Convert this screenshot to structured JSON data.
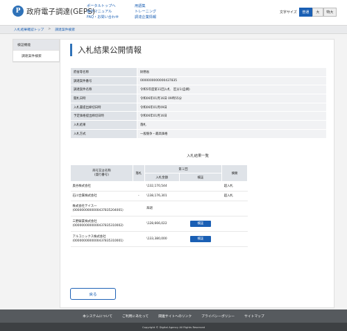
{
  "header": {
    "logo_mark": "P",
    "logo_text": "政府電子調達(GEPS)",
    "links_col1": [
      "ポータルトップへ",
      "操作マニュアル",
      "FAQ・お問い合わせ"
    ],
    "links_col2": [
      "用語集",
      "トレーニング",
      "調達企業情報"
    ],
    "font_size_label": "文字サイズ",
    "font_sizes": [
      "普通",
      "大",
      "特大"
    ],
    "font_size_selected": "普通"
  },
  "breadcrumb": [
    "入札結果確認トップ",
    "調達案件検索"
  ],
  "sidebar": {
    "items": [
      {
        "label": "検証機能"
      },
      {
        "label": "調達案件検索"
      }
    ]
  },
  "main": {
    "title": "入札結果公開情報",
    "info_rows": [
      {
        "label": "府省等名称",
        "value": "財務省"
      },
      {
        "label": "調達案件番号",
        "value": "0000000000000437835"
      },
      {
        "label": "調達案件名称",
        "value": "令和5年度第11回入札　区分1(自網)"
      },
      {
        "label": "開札日時",
        "value": "令和06年01月16日 09時55分"
      },
      {
        "label": "入札書提出締切日時",
        "value": "令和06年01月09日"
      },
      {
        "label": "予定価格提出締切日時",
        "value": "令和06年01月16日"
      },
      {
        "label": "入札結果",
        "value": "落札"
      },
      {
        "label": "入札方式",
        "value": "一般競争・最高価格"
      }
    ],
    "results_title": "入札結果一覧",
    "results_headers": {
      "name": "商号又は名称\n(発行番号)",
      "rank": "落札",
      "round": "第１回",
      "amount": "入札金額",
      "check": "検証",
      "note": "摘要"
    },
    "results_rows": [
      {
        "name": "奥谷株式会社",
        "number": "",
        "rank": "",
        "amount": "\\132,170,544",
        "check": "",
        "note": "超入札"
      },
      {
        "name": "石川合属株式会社",
        "number": "",
        "rank": "-",
        "amount": "\\138,176,301",
        "check": "",
        "note": "超入札"
      },
      {
        "name": "株式会社テイス一",
        "number": "(0000000000000437835204001)",
        "rank": "",
        "amount": "辞退",
        "check": "",
        "note": ""
      },
      {
        "name": "三野鋳業株式会社",
        "number": "(0000000000000437835310002)",
        "rank": "",
        "amount": "\\128,666,022",
        "check": "検証",
        "note": ""
      },
      {
        "name": "アルコニックス株式会社",
        "number": "(0000000000000437835310001)",
        "rank": "",
        "amount": "\\133,380,000",
        "check": "検証",
        "note": ""
      }
    ],
    "back_label": "戻る"
  },
  "footer": {
    "links": [
      "本システムについて",
      "ご利用にあたって",
      "関連サイトへのリンク",
      "プライバシーポリシー",
      "サイトマップ"
    ],
    "copyright": "Copyright © Digital Agency All Rights Reserved"
  },
  "colors": {
    "accent": "#2f72b8",
    "link": "#1a5fb4",
    "label_bg": "#dfe3e8",
    "value_bg": "#f1f2f4",
    "footer_bg": "#565a5e"
  }
}
